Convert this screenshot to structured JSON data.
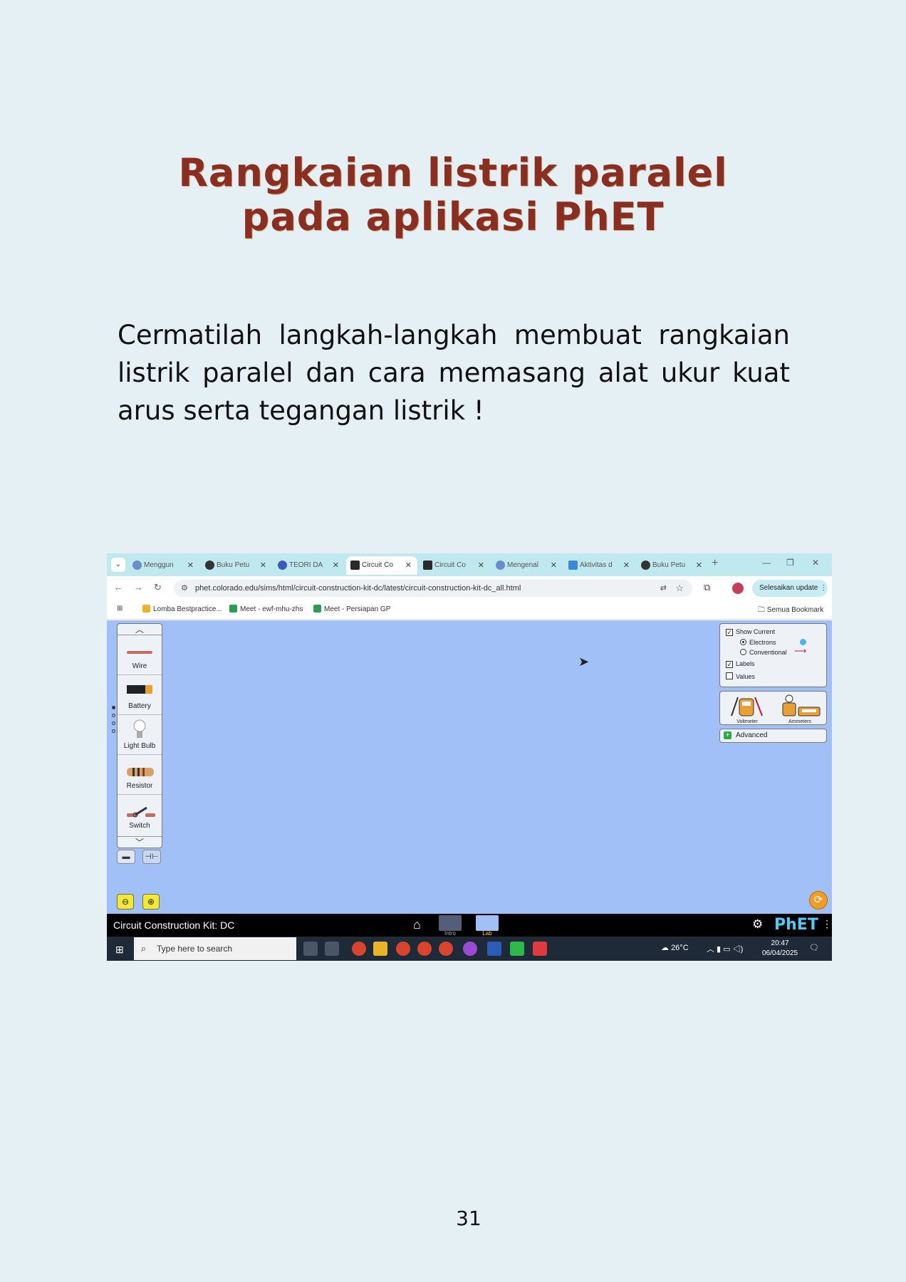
{
  "page": {
    "title_line1": "Rangkaian listrik paralel",
    "title_line2": "pada aplikasi PhET",
    "intro": "Cermatilah langkah-langkah membuat rangkaian listrik paralel dan cara memasang alat ukur kuat arus serta tegangan listrik !",
    "page_number": "31"
  },
  "browser": {
    "tabs": [
      {
        "label": "Menggun",
        "color": "#6a8ccc"
      },
      {
        "label": "Buku Petu",
        "color": "#333333"
      },
      {
        "label": "TEORI DA",
        "color": "#3b5bbd"
      },
      {
        "label": "Circuit Co",
        "color": "#2a2a2a"
      },
      {
        "label": "Circuit Co",
        "color": "#2a2a2a"
      },
      {
        "label": "Mengenal",
        "color": "#6a8ccc"
      },
      {
        "label": "Aktivitas d",
        "color": "#3b8ad6"
      },
      {
        "label": "Buku Petu",
        "color": "#333333"
      }
    ],
    "url": "phet.colorado.edu/sims/html/circuit-construction-kit-dc/latest/circuit-construction-kit-dc_all.html",
    "update_button": "Selesaikan update",
    "bookmarks": [
      {
        "label": "Lomba Bestpractice...",
        "color": "#e8b52a"
      },
      {
        "label": "Meet - ewf-mhu-zhs",
        "color": "#2a9d55"
      },
      {
        "label": "Meet - Persiapan GP",
        "color": "#2a9d55"
      }
    ],
    "all_bookmarks": "Semua Bookmark"
  },
  "phet": {
    "toolbox_items": [
      "Wire",
      "Battery",
      "Light Bulb",
      "Resistor",
      "Switch"
    ],
    "show_current": "Show Current",
    "electrons": "Electrons",
    "conventional": "Conventional",
    "labels": "Labels",
    "values": "Values",
    "voltmeter": "Voltmeter",
    "ammeters": "Ammeters",
    "advanced": "Advanced",
    "sim_title": "Circuit Construction Kit: DC",
    "screens": [
      "Intro",
      "Lab"
    ],
    "logo": "PhET"
  },
  "taskbar": {
    "search_placeholder": "Type here to search",
    "temperature": "26°C",
    "time": "20:47",
    "date": "06/04/2025"
  }
}
